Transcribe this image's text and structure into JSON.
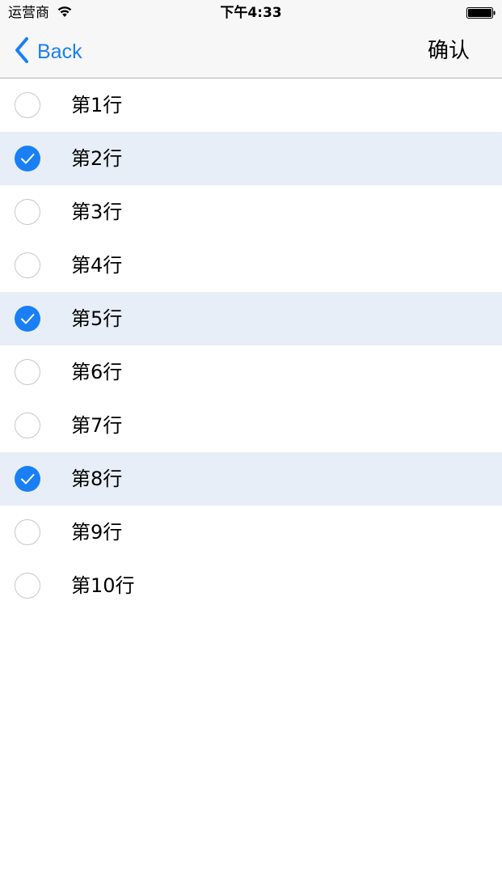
{
  "status_bar": {
    "carrier": "运营商",
    "time": "下午4:33"
  },
  "nav": {
    "back_label": "Back",
    "confirm_label": "确认"
  },
  "colors": {
    "accent": "#1a7ff5",
    "selected_row": "#e8eef7"
  },
  "rows": [
    {
      "label": "第1行",
      "checked": false
    },
    {
      "label": "第2行",
      "checked": true
    },
    {
      "label": "第3行",
      "checked": false
    },
    {
      "label": "第4行",
      "checked": false
    },
    {
      "label": "第5行",
      "checked": true
    },
    {
      "label": "第6行",
      "checked": false
    },
    {
      "label": "第7行",
      "checked": false
    },
    {
      "label": "第8行",
      "checked": true
    },
    {
      "label": "第9行",
      "checked": false
    },
    {
      "label": "第10行",
      "checked": false
    }
  ]
}
